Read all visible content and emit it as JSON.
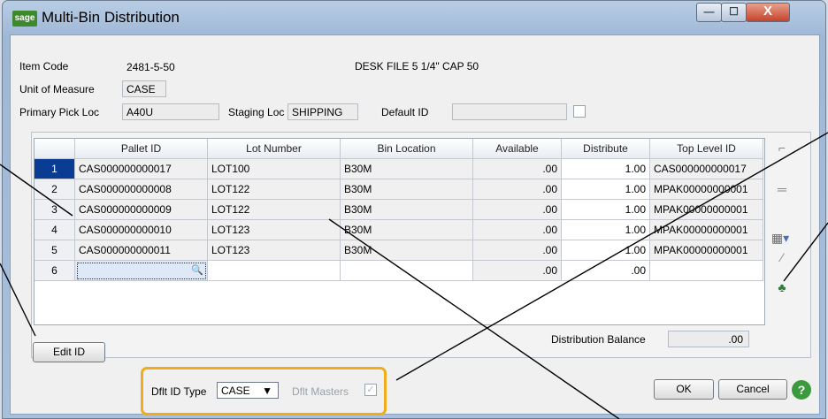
{
  "window": {
    "title": "Multi-Bin Distribution",
    "logo": "sage"
  },
  "header": {
    "item_code_label": "Item Code",
    "item_code": "2481-5-50",
    "item_desc": "DESK FILE 5 1/4\" CAP 50",
    "uom_label": "Unit of Measure",
    "uom": "CASE",
    "primary_pick_label": "Primary Pick Loc",
    "primary_pick": "A40U",
    "staging_label": "Staging Loc",
    "staging": "SHIPPING",
    "default_id_label": "Default ID",
    "default_id": ""
  },
  "grid": {
    "columns": [
      "Pallet ID",
      "Lot Number",
      "Bin Location",
      "Available",
      "Distribute",
      "Top Level ID"
    ],
    "rows": [
      {
        "n": "1",
        "pallet": "CAS000000000017",
        "lot": "LOT100",
        "bin": "B30M",
        "avail": ".00",
        "dist": "1.00",
        "top": "CAS000000000017"
      },
      {
        "n": "2",
        "pallet": "CAS000000000008",
        "lot": "LOT122",
        "bin": "B30M",
        "avail": ".00",
        "dist": "1.00",
        "top": "MPAK00000000001"
      },
      {
        "n": "3",
        "pallet": "CAS000000000009",
        "lot": "LOT122",
        "bin": "B30M",
        "avail": ".00",
        "dist": "1.00",
        "top": "MPAK00000000001"
      },
      {
        "n": "4",
        "pallet": "CAS000000000010",
        "lot": "LOT123",
        "bin": "B30M",
        "avail": ".00",
        "dist": "1.00",
        "top": "MPAK00000000001"
      },
      {
        "n": "5",
        "pallet": "CAS000000000011",
        "lot": "LOT123",
        "bin": "B30M",
        "avail": ".00",
        "dist": "1.00",
        "top": "MPAK00000000001"
      },
      {
        "n": "6",
        "pallet": "",
        "lot": "",
        "bin": "",
        "avail": ".00",
        "dist": ".00",
        "top": ""
      }
    ]
  },
  "footer": {
    "edit_id": "Edit ID",
    "distribution_balance_label": "Distribution Balance",
    "distribution_balance": ".00",
    "dflt_id_type_label": "Dflt ID Type",
    "dflt_id_type": "CASE",
    "dflt_masters_label": "Dflt Masters",
    "ok": "OK",
    "cancel": "Cancel"
  },
  "colors": {
    "highlight": "#f0ac1c",
    "selected_row": "#0a3c93"
  }
}
